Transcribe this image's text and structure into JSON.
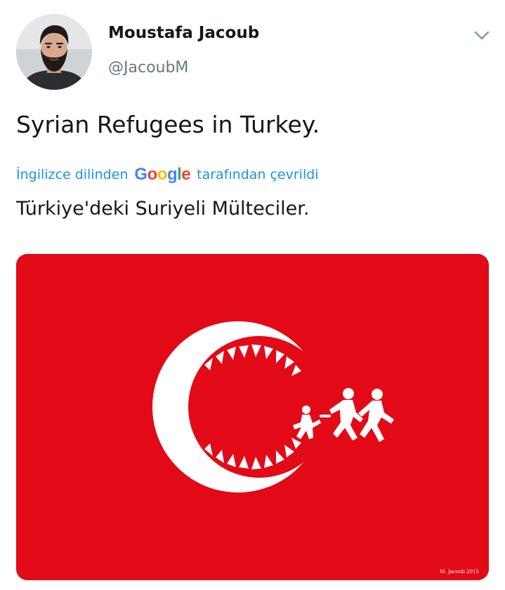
{
  "author": {
    "display_name": "Moustafa Jacoub",
    "handle": "@JacoubM",
    "avatar": "avatar-photo"
  },
  "menu": {
    "icon": "chevron-down-icon"
  },
  "tweet": {
    "text": "Syrian Refugees in Turkey."
  },
  "translation": {
    "prefix": "İngilizce dilinden",
    "provider": "Google",
    "suffix": "tarafından çevrildi",
    "text": "Türkiye'deki Suriyeli Mülteciler."
  },
  "media": {
    "description_icon": "turkish-flag-crescent-shark-jaws-refugees",
    "signature": "M. Jacoub 2015",
    "colors": {
      "flag_red": "#e30a17",
      "emblem": "#ffffff"
    }
  },
  "colors": {
    "link": "#1b95e0",
    "text": "#14171a",
    "secondary": "#657786"
  }
}
